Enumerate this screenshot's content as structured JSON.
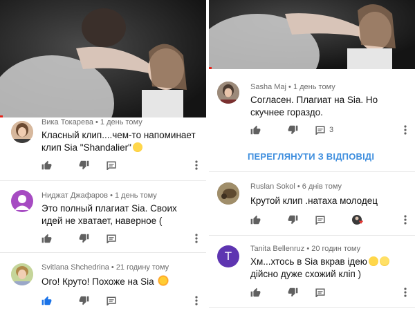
{
  "colors": {
    "accent_blue": "#3e8ede",
    "like_active": "#1a73e8",
    "progress_red": "#e62117",
    "meta_gray": "#6b6b6b"
  },
  "left": {
    "comments": [
      {
        "author": "Вика Токарева",
        "time": "1 день тому",
        "text_line1": "Класный клип....чем-то напоминает",
        "text_line2": "клип Sia \"Shandalier\"",
        "avatar_icon": "user-photo-avatar",
        "emoji": "smiling-face-emoji"
      },
      {
        "author": "Ниджат Джафаров",
        "time": "1 день тому",
        "text_line1": "Это полный плагиат Sia. Своих",
        "text_line2": "идей не хватает, наверное (",
        "avatar_icon": "default-person-avatar"
      },
      {
        "author": "Svitlana Shchedrina",
        "time": "21 годину тому",
        "text_line1": "Ого! Круто! Похоже на Sia",
        "avatar_icon": "user-photo-avatar",
        "emoji": "sun-emoji"
      }
    ]
  },
  "right": {
    "comments": [
      {
        "author": "Sasha Maj",
        "time": "1 день тому",
        "text_line1": "Согласен. Плагиат на Sia. Но",
        "text_line2": "скучнее гораздо.",
        "reply_count": "3",
        "avatar_icon": "user-photo-avatar"
      },
      {
        "author": "Ruslan Sokol",
        "time": "6 днів тому",
        "text_line1": "Крутой клип .натаха молодец",
        "avatar_icon": "user-photo-avatar"
      },
      {
        "author": "Tanita Bellenruz",
        "time": "20 годин тому",
        "text_line1": "Хм...хтось в Sia вкрав ідею",
        "text_line2": "дійсно дуже схожий кліп )",
        "avatar_letter": "T",
        "avatar_color": "#5e35b1",
        "emoji": "laughing-emoji"
      }
    ],
    "show_replies_label": "ПЕРЕГЛЯНУТИ З ВІДПОВІДІ"
  }
}
